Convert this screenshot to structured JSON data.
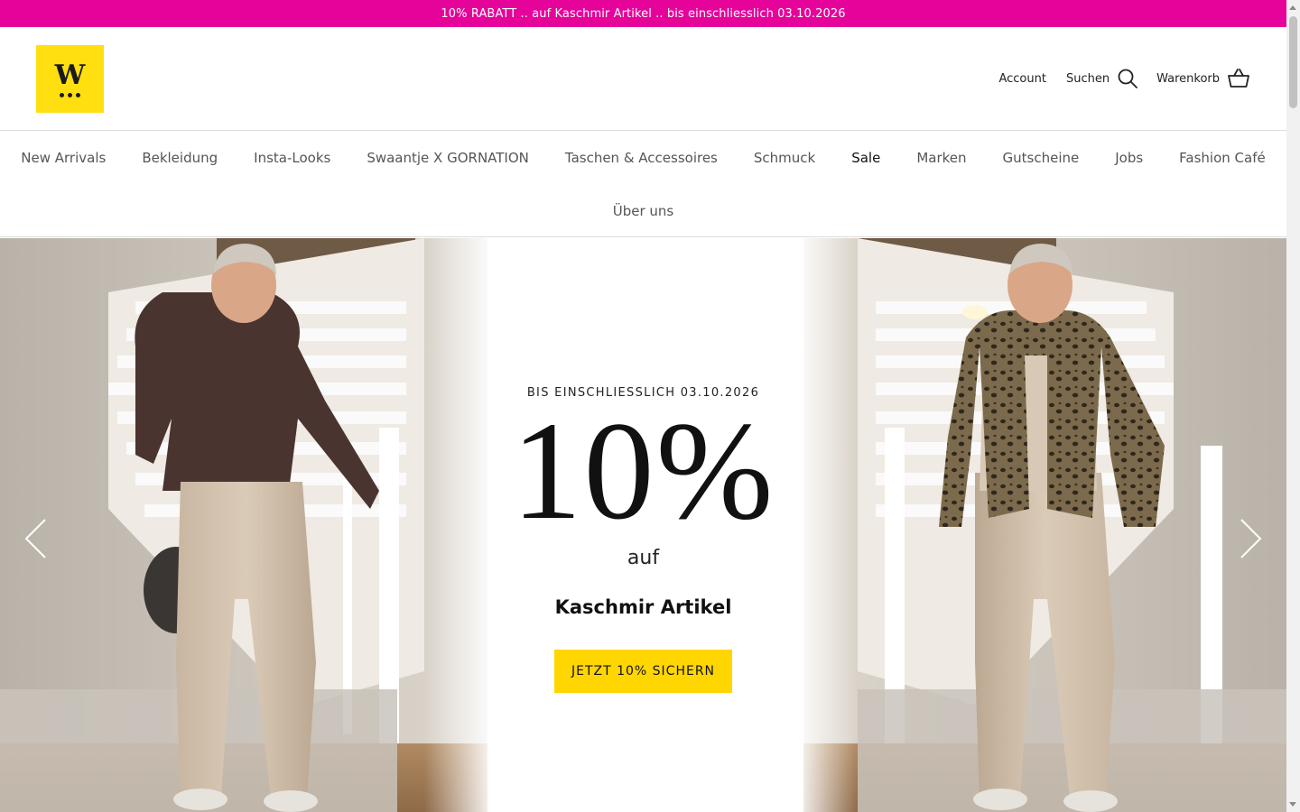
{
  "announcement": {
    "text": "10% RABATT .. auf Kaschmir Artikel .. bis einschliesslich 03.10.2026"
  },
  "header": {
    "logo_letter": "W",
    "account_label": "Account",
    "search_label": "Suchen",
    "cart_label": "Warenkorb"
  },
  "nav": {
    "row1": [
      {
        "label": "New Arrivals"
      },
      {
        "label": "Bekleidung"
      },
      {
        "label": "Insta-Looks"
      },
      {
        "label": "Swaantje X GORNATION"
      },
      {
        "label": "Taschen & Accessoires"
      },
      {
        "label": "Schmuck"
      },
      {
        "label": "Sale"
      },
      {
        "label": "Marken"
      },
      {
        "label": "Gutscheine"
      },
      {
        "label": "Jobs"
      },
      {
        "label": "Fashion Café"
      }
    ],
    "row2": [
      {
        "label": "Über uns"
      }
    ]
  },
  "hero": {
    "eyebrow": "BIS EINSCHLIESSLICH 03.10.2026",
    "headline": "10%",
    "subline": "auf",
    "product": "Kaschmir Artikel",
    "cta_label": "JETZT 10% SICHERN"
  },
  "icons": {
    "search": "search-icon",
    "cart": "basket-icon",
    "prev": "chevron-left-icon",
    "next": "chevron-right-icon"
  },
  "colors": {
    "announcement_bg": "#e6039a",
    "logo_bg": "#ffdf0f",
    "cta_bg": "#ffd600"
  }
}
